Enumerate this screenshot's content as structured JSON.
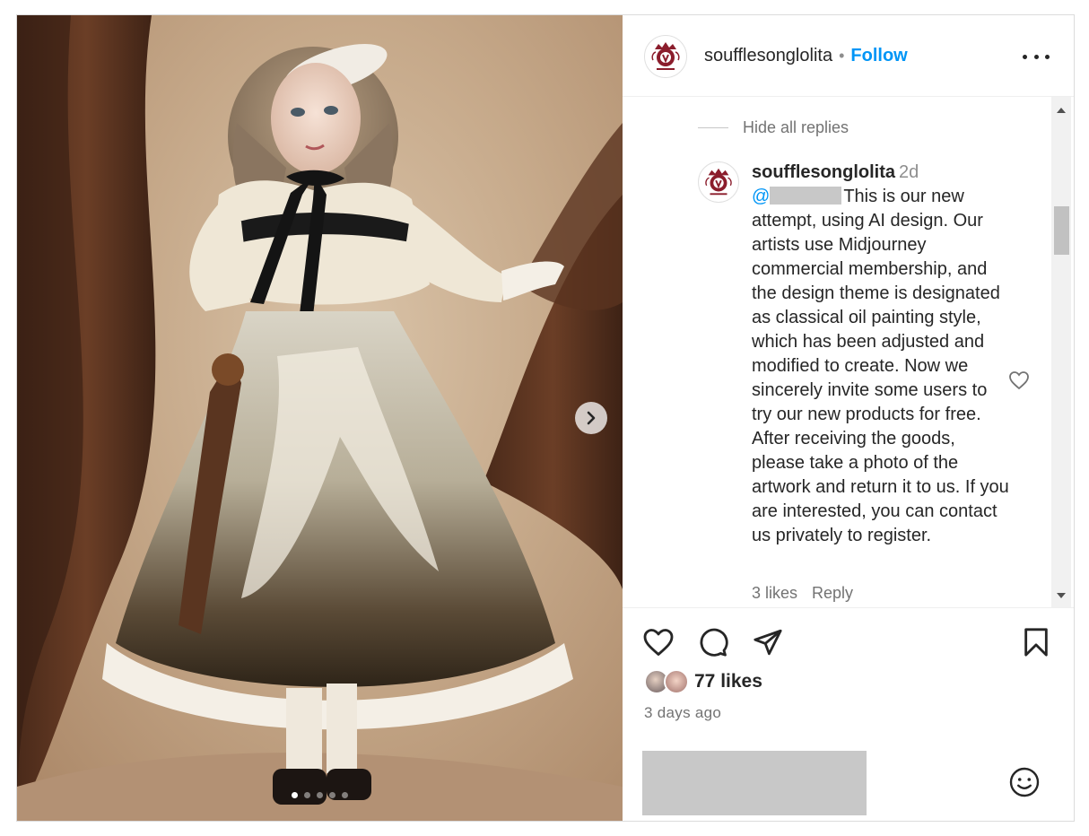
{
  "post": {
    "username": "soufflesonglolita",
    "separator": "•",
    "follow_label": "Follow"
  },
  "media": {
    "total_slides": 5,
    "active_slide": 1
  },
  "comments": {
    "hide_replies_label": "Hide all replies",
    "reply": {
      "username": "soufflesonglolita",
      "time": "2d",
      "mention_prefix": "@",
      "text": "This is our new attempt, using AI design. Our artists use Midjourney commercial membership, and the design theme is designated as classical oil painting style, which has been adjusted and modified to create. Now we sincerely invite some users to try our new products for free. After receiving the goods, please take a photo of the artwork and return it to us. If you are interested, you can contact us privately to register.",
      "likes": "3 likes",
      "reply_label": "Reply"
    }
  },
  "stats": {
    "likes": "77 likes",
    "posted": "3 days ago"
  },
  "colors": {
    "accent": "#0095f6",
    "text": "#262626",
    "secondary": "#737373",
    "border": "#dbdbdb"
  },
  "icons": {
    "like": "heart-icon",
    "comment": "comment-icon",
    "share": "send-icon",
    "save": "bookmark-icon",
    "emoji": "emoji-icon",
    "more": "more-options-icon"
  }
}
